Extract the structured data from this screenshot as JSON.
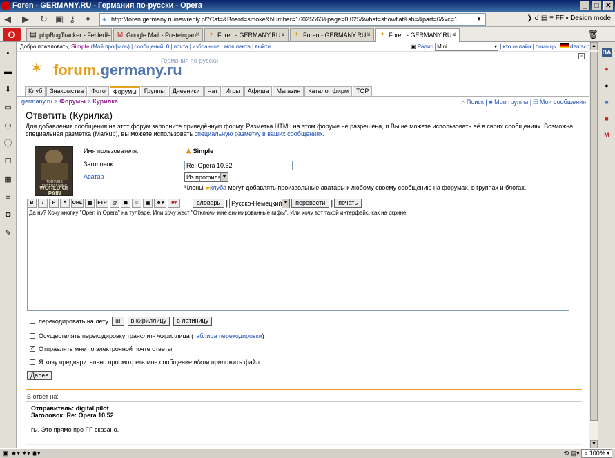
{
  "window": {
    "title": "Foren - GERMANY.RU - Германия по-русски - Opera"
  },
  "address": {
    "url": "http://foren.germany.ru/newreply.pl?Cat=&Board=smoke&Number=16025563&page=0.025&what=showflat&sb=&part=6&vc=1",
    "design_mode": "Design mode",
    "ff_label": "FF"
  },
  "tabs": [
    {
      "label": "phpBugTracker - Fehlerliste"
    },
    {
      "label": "Google Mail - Posteingan..."
    },
    {
      "label": "Foren - GERMANY.RU - ..."
    },
    {
      "label": "Foren - GERMANY.RU - ..."
    },
    {
      "label": "Foren - GERMANY.RU - ..."
    }
  ],
  "topstrip": {
    "welcome": "Добро пожаловать,",
    "user": "Simple",
    "links": "(Мой профиль) | сообщений: 0 | почта | избранное | моя лента | выйти",
    "radio": "Радио",
    "mini": "Mini",
    "right": "| кто онлайн | помощь |",
    "lang": "deutsch"
  },
  "logo": {
    "subtitle": "Германия по-русски",
    "name_a": "forum.",
    "name_b": "germany.ru"
  },
  "menu": [
    "Клуб",
    "Знакомства",
    "Фото",
    "Форумы",
    "Группы",
    "Дневники",
    "Чат",
    "Игры",
    "Афиша",
    "Магазин",
    "Каталог фирм",
    "TOP"
  ],
  "breadcrumb": {
    "root": "germany.ru",
    "sep": ">",
    "forums": "Форумы",
    "board": "Курилка"
  },
  "toplinks": {
    "search": "Поиск",
    "groups": "Мои группы",
    "messages": "Мои сообщения"
  },
  "page": {
    "title": "Ответить (Курилка)",
    "intro": "Для добавления сообщения на этот форум заполните приведённую форму. Разметка HTML на этом форуме не разрешена, и Вы не можете использовать её в своих сообщениях. Возможна специальная разметка (Markup), вы можете использовать ",
    "intro_link": "специальную разметку в ваших сообщениях",
    "intro_end": "."
  },
  "avatar_text": {
    "t1": "TORTURE ENTERTAINING",
    "t2": "WORLD OF PAIN"
  },
  "form": {
    "username_label": "Имя пользователя:",
    "username": "Simple",
    "subject_label": "Заголовок:",
    "subject": "Re: Opera 10.52",
    "avatar_label": "Аватар",
    "avatar_select": "Из профиля",
    "avatar_note_a": "Члены",
    "avatar_note_link": "клуба",
    "avatar_note_b": "могут добавлять произвольные аватары к любому своему сообщению на форумах, в группах и блогах.",
    "toolbar": [
      "B",
      "I",
      "P",
      "",
      "URL",
      "",
      "FTP",
      "",
      "",
      "",
      "",
      "",
      ""
    ],
    "dict_button": "словарь",
    "lang_select": "Русско-Немецкий",
    "translate_button": "перевести",
    "print_button": "печать",
    "body": "Да ну? Хочу кнопку \"Open in Opera\" на тулбаре. Или хочу жест \"Отключи мне анимированные гифы\". Или хочу вот такой интерфейс, как на скрине.",
    "recode_label": "перекодировать на лету",
    "to_cyr": "в кириллицу",
    "to_lat": "в латиницу",
    "translit_label": "Осуществлять перекодировку транслит->кириллица (",
    "translit_link": "таблица перекодировки",
    "translit_end": ")",
    "email_label": "Отправлять мне по электронной почте ответы",
    "preview_label": "Я хочу предварительно просмотреть мое сообщение и/или приложить файл",
    "next_button": "Далее"
  },
  "reply": {
    "head": "В ответ на:",
    "sender": "Отправитель: digital.pilot",
    "subject": "Заголовок: Re: Opera 10.52",
    "message": "гы. Это прямо про FF сказано."
  },
  "status": {
    "zoom": "100%"
  }
}
